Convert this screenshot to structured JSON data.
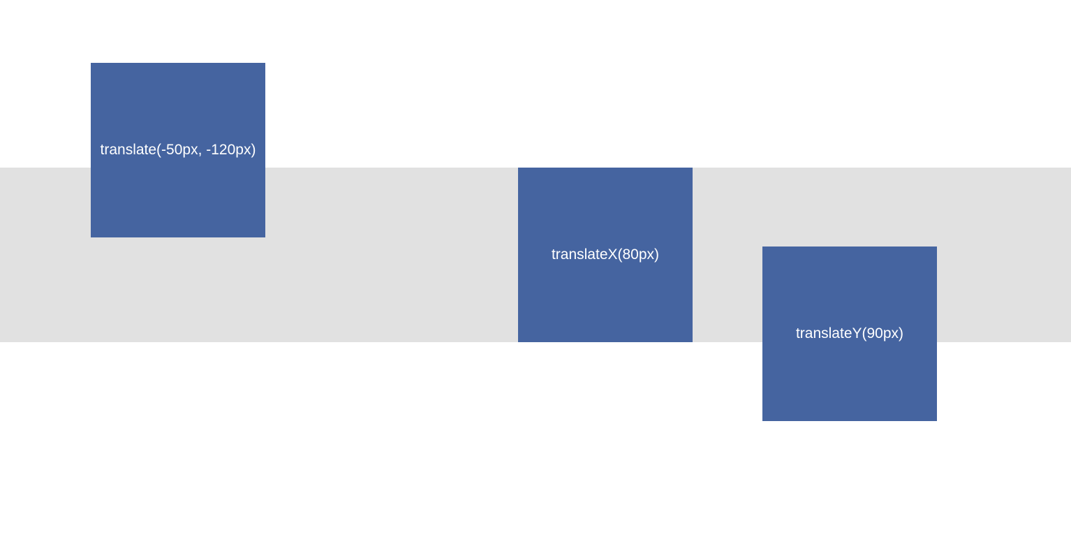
{
  "colors": {
    "page_background": "#ffffff",
    "band_background": "#e1e1e1",
    "box_fill": "#4564a0",
    "box_text": "#ffffff"
  },
  "boxes": [
    {
      "label": "translate(-50px, -120px)"
    },
    {
      "label": "translateX(80px)"
    },
    {
      "label": "translateY(90px)"
    }
  ]
}
